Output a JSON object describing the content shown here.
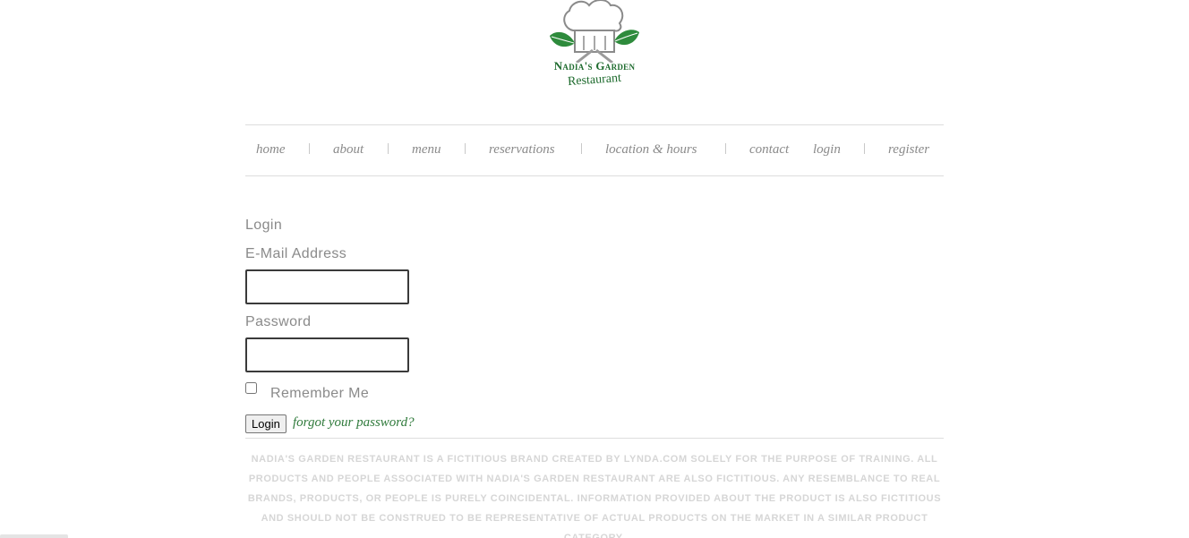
{
  "logo": {
    "title": "Nadia's Garden",
    "subtitle": "Restaurant"
  },
  "nav": {
    "items": [
      {
        "label": "home"
      },
      {
        "label": "about"
      },
      {
        "label": "menu"
      },
      {
        "label": "reservations"
      },
      {
        "label": "location & hours"
      },
      {
        "label": "contact"
      },
      {
        "label": "login"
      },
      {
        "label": "register"
      }
    ]
  },
  "form": {
    "heading": "Login",
    "email_label": "E-Mail Address",
    "email_value": "",
    "password_label": "Password",
    "password_value": "",
    "remember_label": "Remember Me",
    "remember_checked": false,
    "submit_label": "Login",
    "forgot_label": "forgot your password?"
  },
  "footer": {
    "disclaimer": "Nadia's Garden Restaurant is a fictitious brand created by lynda.com solely for the purpose of training. All products and people associated with Nadia's Garden Restaurant are also fictitious. Any resemblance to real brands, products, or people is purely coincidental. Information provided about the product is also fictitious and should not be construed to be representative of actual products on the market in a similar product category."
  },
  "colors": {
    "brand_green": "#1e6b2e",
    "link_green": "#2f7a3b",
    "muted_text": "#8a8a8a"
  }
}
